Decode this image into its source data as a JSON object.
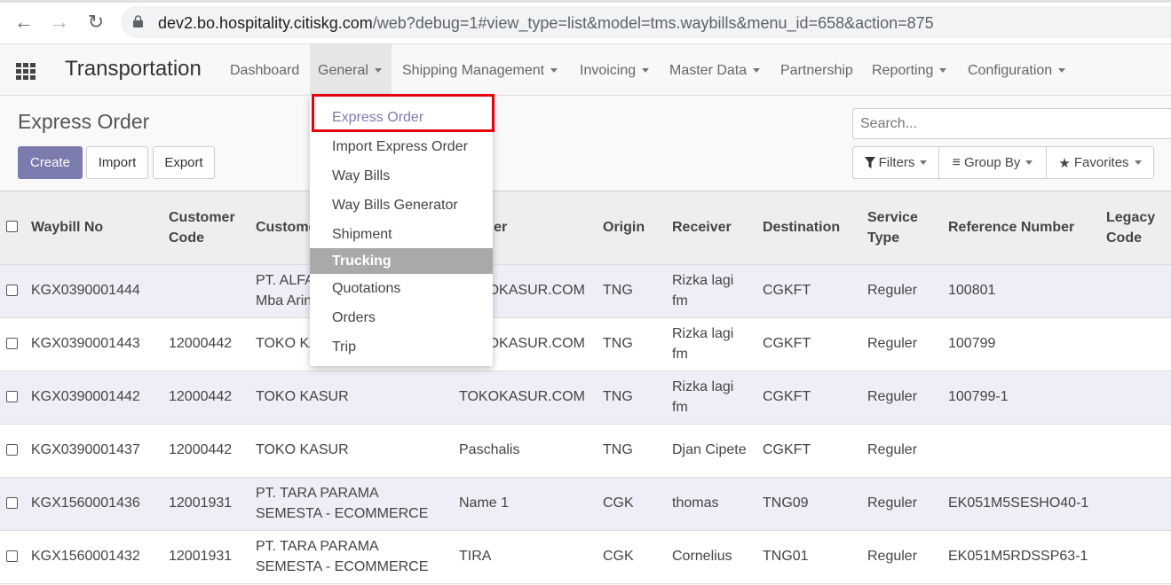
{
  "browser": {
    "url_host": "dev2.bo.hospitality.citiskg.com",
    "url_path": "/web?debug=1#view_type=list&model=tms.waybills&menu_id=658&action=875"
  },
  "app": {
    "brand": "Transportation",
    "menu": [
      {
        "label": "Dashboard",
        "dropdown": false
      },
      {
        "label": "General",
        "dropdown": true
      },
      {
        "label": "Shipping Management",
        "dropdown": true
      },
      {
        "label": "Invoicing",
        "dropdown": true
      },
      {
        "label": "Master Data",
        "dropdown": true
      },
      {
        "label": "Partnership",
        "dropdown": false
      },
      {
        "label": "Reporting",
        "dropdown": true
      },
      {
        "label": "Configuration",
        "dropdown": true
      }
    ]
  },
  "general_dropdown": {
    "items": [
      "Express Order",
      "Import Express Order",
      "Way Bills",
      "Way Bills Generator",
      "Shipment",
      "Trucking",
      "Quotations",
      "Orders",
      "Trip"
    ],
    "active": "Express Order",
    "hovered": "Trucking"
  },
  "page": {
    "title": "Express Order",
    "create": "Create",
    "import": "Import",
    "export": "Export",
    "search_placeholder": "Search...",
    "filters": "Filters",
    "group_by": "Group By",
    "favorites": "Favorites"
  },
  "table": {
    "headers": {
      "waybill": "Waybill No",
      "cust_code_1": "Customer",
      "cust_code_2": "Code",
      "customer": "Customer",
      "sender": "Sender",
      "origin": "Origin",
      "receiver": "Receiver",
      "destination": "Destination",
      "service_1": "Service",
      "service_2": "Type",
      "reference": "Reference Number",
      "legacy_1": "Legacy",
      "legacy_2": "Code"
    },
    "rows": [
      {
        "waybill": "KGX0390001444",
        "cust_code": "",
        "customer_1": "PT. ALFA",
        "customer_2": "Mba Arin",
        "sender": "TOKOKASUR.COM",
        "origin": "TNG",
        "receiver_1": "Rizka lagi",
        "receiver_2": "fm",
        "destination": "CGKFT",
        "service": "Reguler",
        "reference": "100801"
      },
      {
        "waybill": "KGX0390001443",
        "cust_code": "12000442",
        "customer_1": "TOKO KASUR",
        "customer_2": "",
        "sender": "TOKOKASUR.COM",
        "origin": "TNG",
        "receiver_1": "Rizka lagi",
        "receiver_2": "fm",
        "destination": "CGKFT",
        "service": "Reguler",
        "reference": "100799"
      },
      {
        "waybill": "KGX0390001442",
        "cust_code": "12000442",
        "customer_1": "TOKO KASUR",
        "customer_2": "",
        "sender": "TOKOKASUR.COM",
        "origin": "TNG",
        "receiver_1": "Rizka lagi",
        "receiver_2": "fm",
        "destination": "CGKFT",
        "service": "Reguler",
        "reference": "100799-1"
      },
      {
        "waybill": "KGX0390001437",
        "cust_code": "12000442",
        "customer_1": "TOKO KASUR",
        "customer_2": "",
        "sender": "Paschalis",
        "origin": "TNG",
        "receiver_1": "Djan Cipete",
        "receiver_2": "",
        "destination": "CGKFT",
        "service": "Reguler",
        "reference": ""
      },
      {
        "waybill": "KGX1560001436",
        "cust_code": "12001931",
        "customer_1": "PT. TARA PARAMA",
        "customer_2": "SEMESTA - ECOMMERCE",
        "sender": "Name 1",
        "origin": "CGK",
        "receiver_1": "thomas",
        "receiver_2": "",
        "destination": "TNG09",
        "service": "Reguler",
        "reference": "EK051M5SESHO40-1"
      },
      {
        "waybill": "KGX1560001432",
        "cust_code": "12001931",
        "customer_1": "PT. TARA PARAMA",
        "customer_2": "SEMESTA - ECOMMERCE",
        "sender": "TIRA",
        "origin": "CGK",
        "receiver_1": "Cornelius",
        "receiver_2": "",
        "destination": "TNG01",
        "service": "Reguler",
        "reference": "EK051M5RDSSP63-1"
      }
    ]
  },
  "colors": {
    "primary": "#7c7bad",
    "highlight_box": "#e8000b",
    "hover": "#a9a9a9"
  }
}
